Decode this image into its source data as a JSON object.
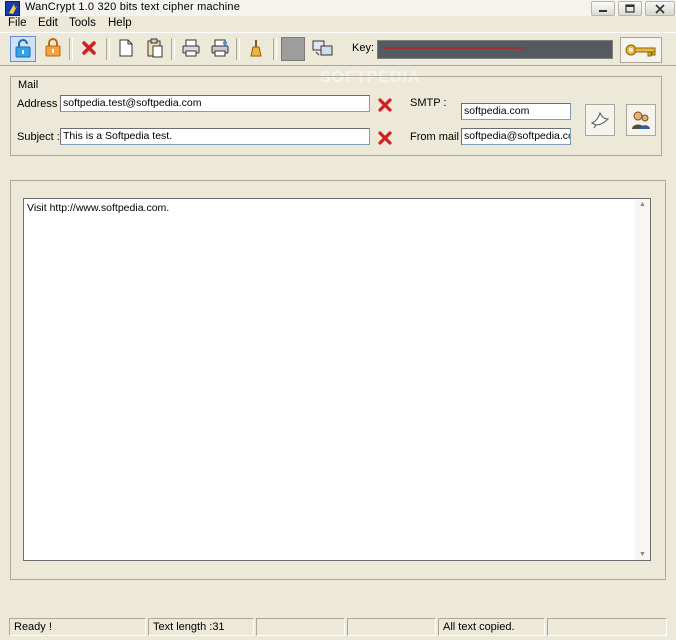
{
  "window": {
    "title": "WanCrypt 1.0     320 bits   text cipher machine"
  },
  "menu": [
    "File",
    "Edit",
    "Tools",
    "Help"
  ],
  "toolbar": {
    "icons": [
      "lock-open-icon",
      "lock-closed-icon",
      "delete-icon",
      "new-doc-icon",
      "paste-icon",
      "print-icon",
      "print-preview-icon",
      "clear-icon",
      "gray-box-icon",
      "screens-icon",
      "key-icon"
    ],
    "key_label": "Key:",
    "watermark": "SOFTPEDIA"
  },
  "mail": {
    "legend": "Mail",
    "address_label": "Address :",
    "address_value": "softpedia.test@softpedia.com",
    "subject_label": "Subject :",
    "subject_value": "This is a Softpedia test.",
    "smtp_label": "SMTP :",
    "smtp_value": "softpedia.com",
    "from_label": "From mail :",
    "from_value": "softpedia@softpedia.com"
  },
  "editor": {
    "text": "Visit http://www.softpedia.com."
  },
  "status": {
    "ready": "Ready !",
    "text_length": "Text length :31",
    "cell3": "",
    "cell4": "",
    "copied": "All text copied.",
    "cell6": ""
  },
  "colors": {
    "background": "#ece9d8",
    "key_field": "#535a60",
    "delete_red": "#d21f1f"
  }
}
